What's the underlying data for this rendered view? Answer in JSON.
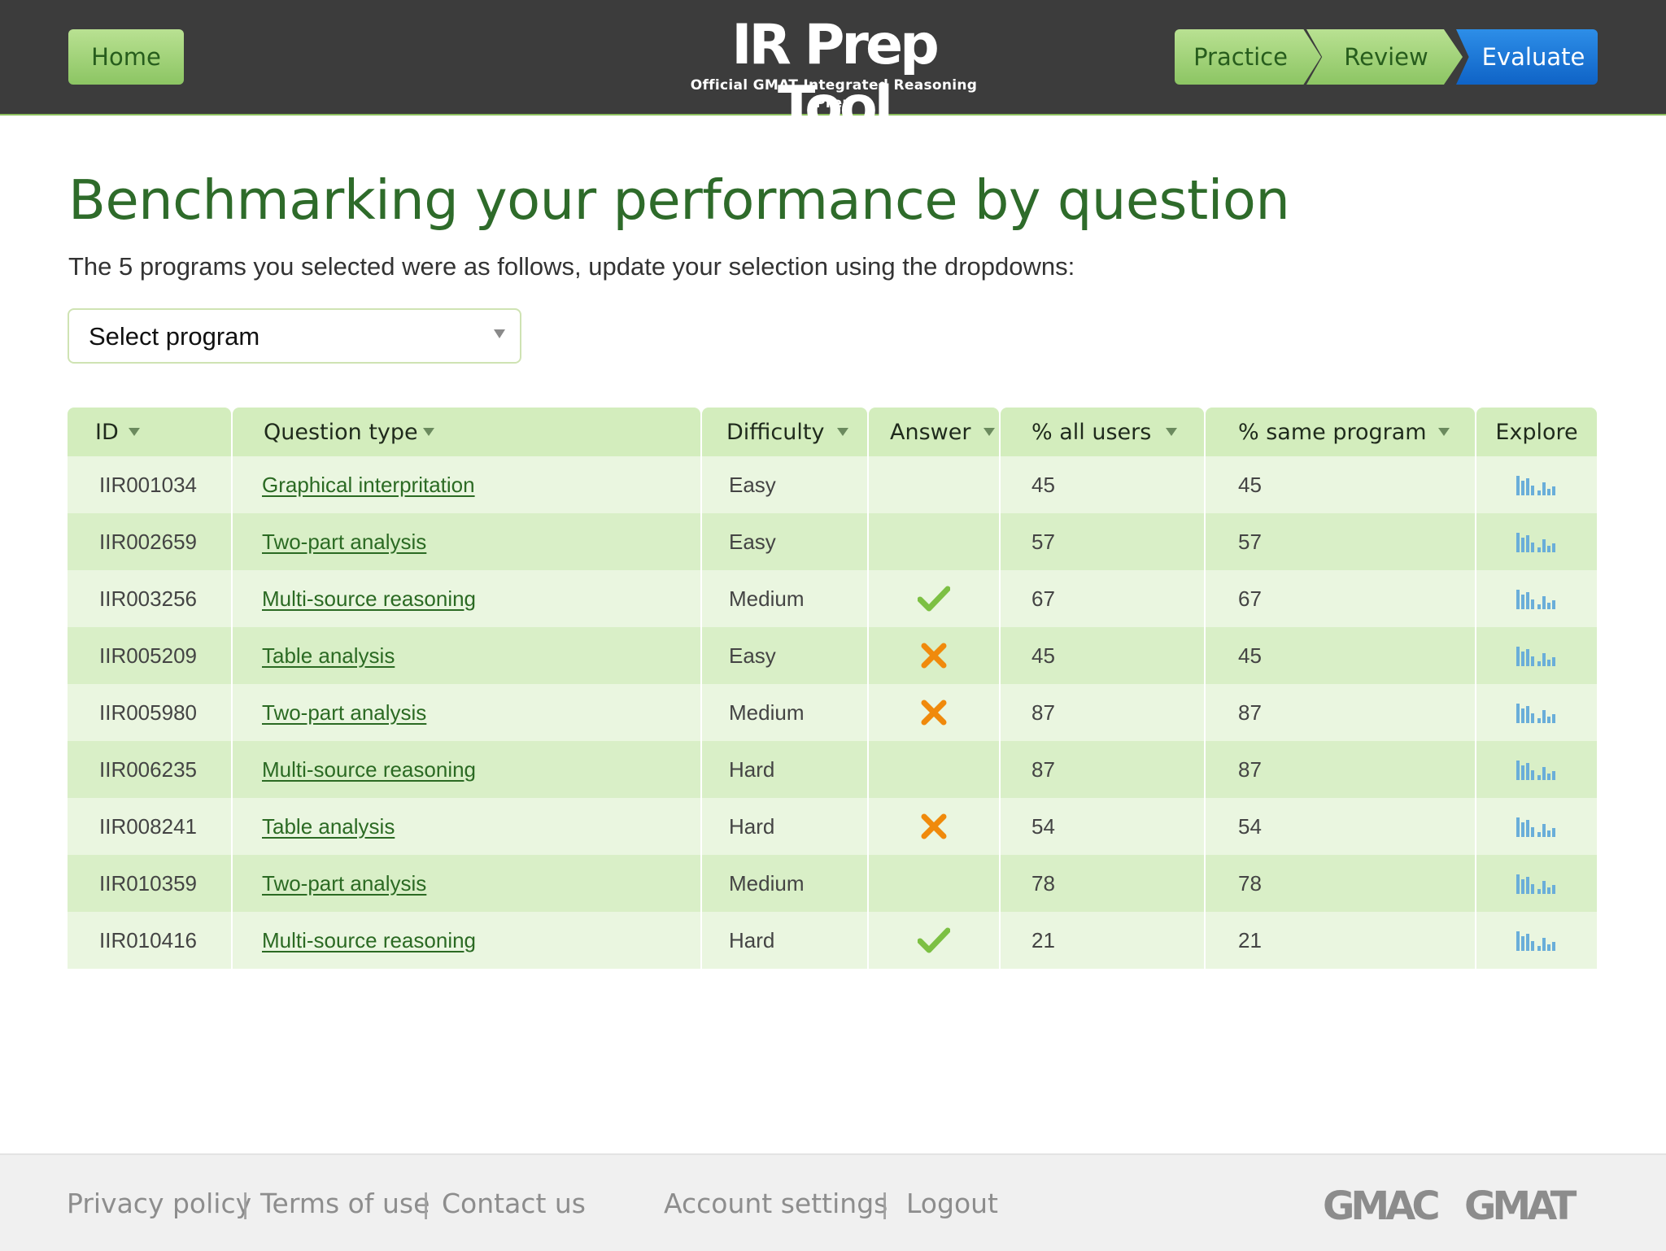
{
  "header": {
    "home_label": "Home",
    "logo_title": "IR Prep Tool",
    "logo_subtitle": "Official GMAT Integrated Reasoning Prep",
    "steps": [
      {
        "label": "Practice",
        "active": false
      },
      {
        "label": "Review",
        "active": false
      },
      {
        "label": "Evaluate",
        "active": true
      }
    ]
  },
  "main": {
    "title": "Benchmarking your performance by question",
    "intro": "The 5 programs you selected were as follows, update your selection using the dropdowns:",
    "program_select": {
      "value": "Select program"
    }
  },
  "table": {
    "columns": [
      {
        "label": "ID",
        "sortable": true
      },
      {
        "label": "Question type",
        "sortable": true
      },
      {
        "label": "Difficulty",
        "sortable": true
      },
      {
        "label": "Answer",
        "sortable": true
      },
      {
        "label": "% all users",
        "sortable": true
      },
      {
        "label": "% same program",
        "sortable": true
      },
      {
        "label": "Explore",
        "sortable": false
      }
    ],
    "rows": [
      {
        "id": "IIR001034",
        "type": "Graphical interpritation",
        "difficulty": "Easy",
        "answer": "none",
        "all_users": "45",
        "same_program": "45"
      },
      {
        "id": "IIR002659",
        "type": "Two-part analysis",
        "difficulty": "Easy",
        "answer": "none",
        "all_users": "57",
        "same_program": "57"
      },
      {
        "id": "IIR003256",
        "type": "Multi-source reasoning",
        "difficulty": "Medium",
        "answer": "correct",
        "all_users": "67",
        "same_program": "67"
      },
      {
        "id": "IIR005209",
        "type": "Table analysis",
        "difficulty": "Easy",
        "answer": "wrong",
        "all_users": "45",
        "same_program": "45"
      },
      {
        "id": "IIR005980",
        "type": "Two-part analysis",
        "difficulty": "Medium",
        "answer": "wrong",
        "all_users": "87",
        "same_program": "87"
      },
      {
        "id": "IIR006235",
        "type": "Multi-source reasoning",
        "difficulty": "Hard",
        "answer": "none",
        "all_users": "87",
        "same_program": "87"
      },
      {
        "id": "IIR008241",
        "type": "Table analysis",
        "difficulty": "Hard",
        "answer": "wrong",
        "all_users": "54",
        "same_program": "54"
      },
      {
        "id": "IIR010359",
        "type": "Two-part analysis",
        "difficulty": "Medium",
        "answer": "none",
        "all_users": "78",
        "same_program": "78"
      },
      {
        "id": "IIR010416",
        "type": "Multi-source reasoning",
        "difficulty": "Hard",
        "answer": "correct",
        "all_users": "21",
        "same_program": "21"
      }
    ],
    "icons": {
      "correct": "check-icon",
      "wrong": "cross-icon",
      "explore": "bar-chart-icon"
    }
  },
  "footer": {
    "links_left": [
      "Privacy policy",
      "Terms of use",
      "Contact us"
    ],
    "links_right": [
      "Account settings",
      "Logout"
    ],
    "separator": "|",
    "brands": [
      "GMAC",
      "GMAT"
    ]
  },
  "colors": {
    "header_bg": "#3c3c3c",
    "accent_green": "#2e6b2a",
    "button_green": "#a5d47b",
    "active_blue": "#1a73d8",
    "check_green": "#7cc043",
    "cross_orange": "#f08a0c",
    "explore_blue": "#6aaed9"
  }
}
